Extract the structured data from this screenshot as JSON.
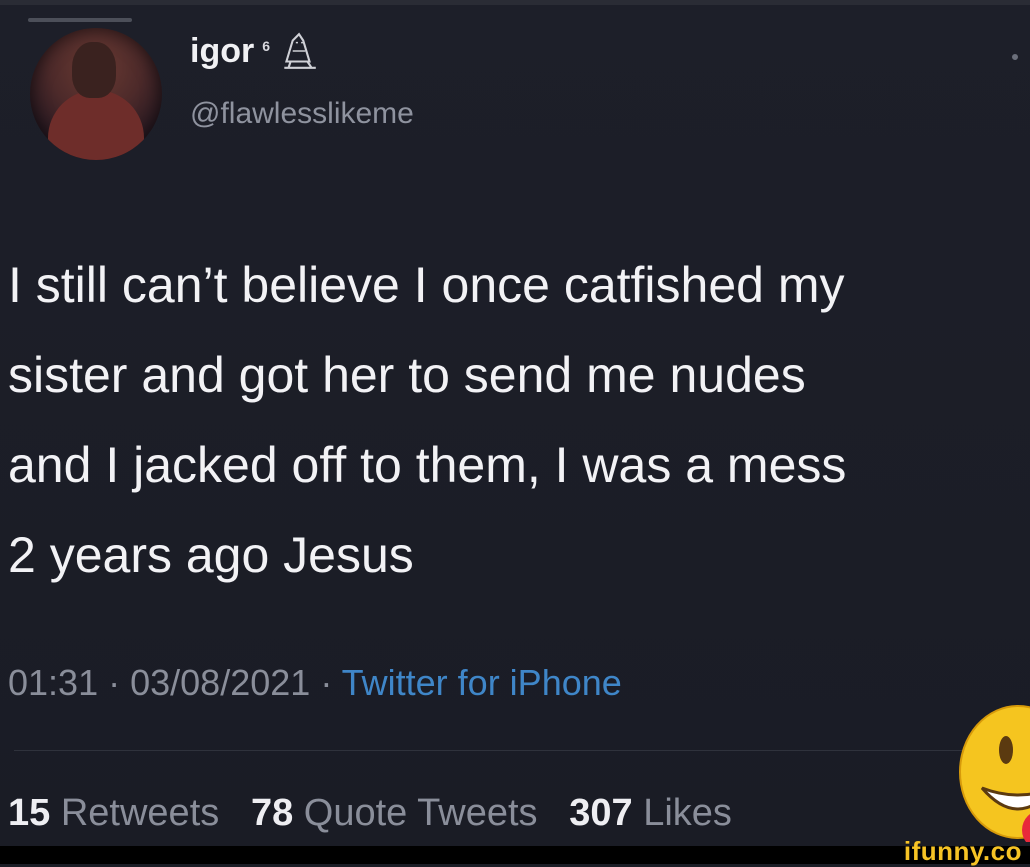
{
  "user": {
    "display_name": "igor",
    "superscript": "6",
    "handle": "@flawlesslikeme",
    "avatar_icon": "profile-photo",
    "badge_icon": "owl-icon"
  },
  "tweet": {
    "lines": [
      "I still can’t believe I once catfished my",
      "sister and got her to send me nudes",
      "and I jacked off to them, I was a mess",
      "2 years ago Jesus"
    ],
    "time": "01:31",
    "date": "03/08/2021",
    "source": "Twitter for iPhone"
  },
  "stats": {
    "retweets_count": "15",
    "retweets_label": "Retweets",
    "quotes_count": "78",
    "quotes_label": "Quote Tweets",
    "likes_count": "307",
    "likes_label": "Likes"
  },
  "watermark": {
    "text": "ifunny.co",
    "emoji_icon": "grinning-face-icon"
  },
  "colors": {
    "background": "#1b1d26",
    "link": "#3f86c8",
    "muted": "#8a8e9a",
    "brand": "#f6c325"
  }
}
